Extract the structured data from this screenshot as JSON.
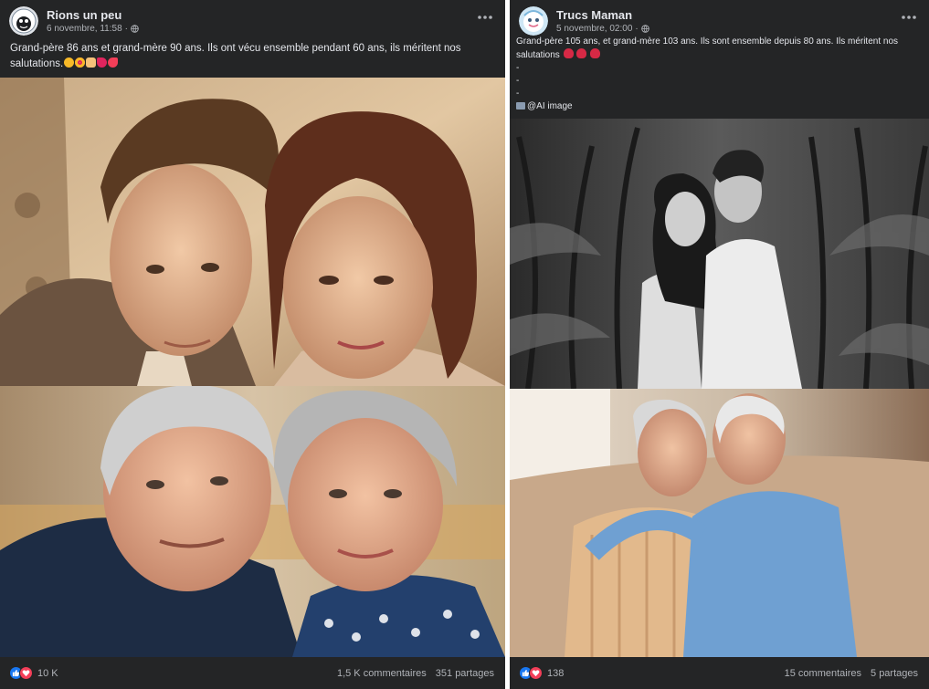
{
  "left_post": {
    "page_name": "Rions un peu",
    "date": "6 novembre, 11:58",
    "dot": "·",
    "caption_line1": "Grand-père 86 ans et grand-mère 90 ans. Ils ont vécu ensemble pendant 60 ans, ils méritent nos",
    "caption_line2": "salutations.",
    "caption_emojis": [
      "smiling-face",
      "heart-eyes-face",
      "folded-hands",
      "heart",
      "hearts"
    ],
    "reaction_count": "10 K",
    "comments": "1,5 K commentaires",
    "shares": "351 partages"
  },
  "right_post": {
    "page_name": "Trucs Maman",
    "date": "5 novembre, 02:00",
    "dot": "·",
    "caption_line1": "Grand-père 105 ans, et grand-mère 103 ans. Ils sont ensemble depuis 80 ans. Ils méritent nos",
    "caption_line2": "salutations",
    "caption_emojis": [
      "rose",
      "rose",
      "rose"
    ],
    "dash1": "-",
    "dash2": "-",
    "dash3": "-",
    "credit": "@AI image",
    "reaction_count": "138",
    "comments": "15 commentaires",
    "shares": "5 partages"
  },
  "colors": {
    "card_bg": "#242526",
    "primary_text": "#e4e6eb",
    "secondary_text": "#b0b3b8",
    "like_blue": "#1877f2",
    "love_red": "#f33e58"
  },
  "icons": {
    "more": "more-horizontal-icon",
    "privacy": "globe-icon",
    "like": "like-thumb-icon",
    "love": "love-heart-icon"
  }
}
